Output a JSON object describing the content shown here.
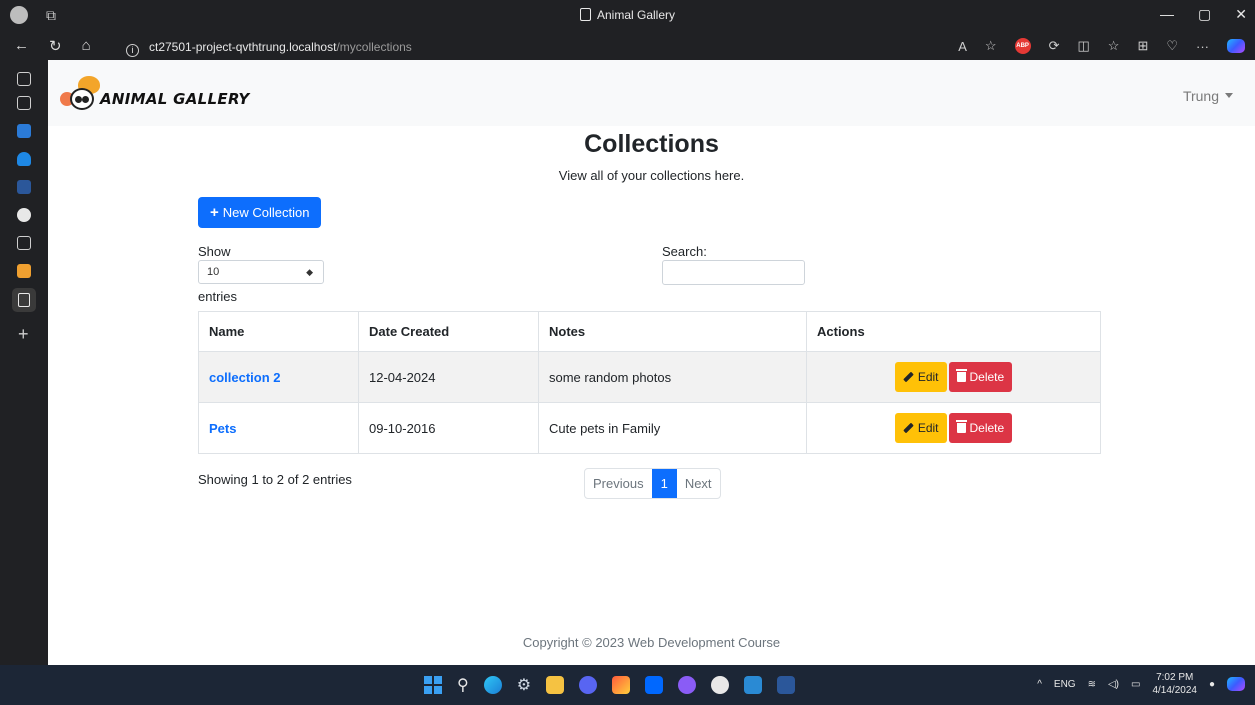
{
  "window": {
    "title": "Animal Gallery"
  },
  "browser": {
    "url_host": "ct27501-project-qvthtrung.localhost",
    "url_path": "/mycollections",
    "abp_label": "ABP",
    "read_aloud_label": "A"
  },
  "site": {
    "logo_text": "ANIMAL GALLERY",
    "user_name": "Trung"
  },
  "page": {
    "title": "Collections",
    "subtitle": "View all of your collections here.",
    "new_button": "New Collection",
    "show_label": "Show",
    "entries_label": "entries",
    "length_value": "10",
    "search_label": "Search:",
    "search_value": ""
  },
  "table": {
    "headers": [
      "Name",
      "Date Created",
      "Notes",
      "Actions"
    ],
    "rows": [
      {
        "name": "collection 2",
        "date": "12-04-2024",
        "notes": "some random photos"
      },
      {
        "name": "Pets",
        "date": "09-10-2016",
        "notes": "Cute pets in Family"
      }
    ],
    "edit_label": "Edit",
    "delete_label": "Delete"
  },
  "pagination": {
    "info": "Showing 1 to 2 of 2 entries",
    "previous": "Previous",
    "current": "1",
    "next": "Next"
  },
  "footer": {
    "text": "Copyright © 2023 Web Development Course"
  },
  "taskbar": {
    "lang": "ENG",
    "time": "7:02 PM",
    "date": "4/14/2024"
  },
  "colors": {
    "primary": "#0d6efd",
    "warning": "#ffc107",
    "danger": "#dc3545"
  }
}
